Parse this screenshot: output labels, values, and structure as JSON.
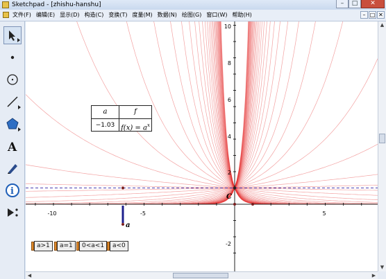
{
  "window": {
    "title": "Sketchpad - [zhishu-hanshu]",
    "buttons": [
      "–",
      "□",
      "✕"
    ]
  },
  "menubar": {
    "items": [
      "文件(F)",
      "编辑(E)",
      "显示(D)",
      "构造(C)",
      "变换(T)",
      "度量(M)",
      "数据(N)",
      "绘图(G)",
      "窗口(W)",
      "帮助(H)"
    ],
    "doc_buttons": [
      "–",
      "□",
      "✕"
    ]
  },
  "toolbox": {
    "tools": [
      "arrow-select-tool",
      "point-tool",
      "compass-tool",
      "straightedge-tool",
      "polygon-tool",
      "text-tool",
      "marker-tool",
      "information-tool",
      "custom-tool"
    ]
  },
  "graph": {
    "x_ticks": [
      "-10",
      "-5",
      "5"
    ],
    "y_ticks": [
      "10",
      "8",
      "6",
      "4",
      "2",
      "-2"
    ],
    "point_C_label": "C",
    "slider_label": "a",
    "colors": {
      "curve": "#e53030",
      "dashed_line": "#4b3db0",
      "axis": "#222222",
      "slider": "#1d1f8c"
    }
  },
  "function_table": {
    "headers": [
      "a",
      "f"
    ],
    "a_value": "−1.03",
    "function_text": "f(x) = a",
    "exponent": "x"
  },
  "action_buttons": [
    "a>1",
    "a=1",
    "0<a<1",
    "a<0"
  ]
}
